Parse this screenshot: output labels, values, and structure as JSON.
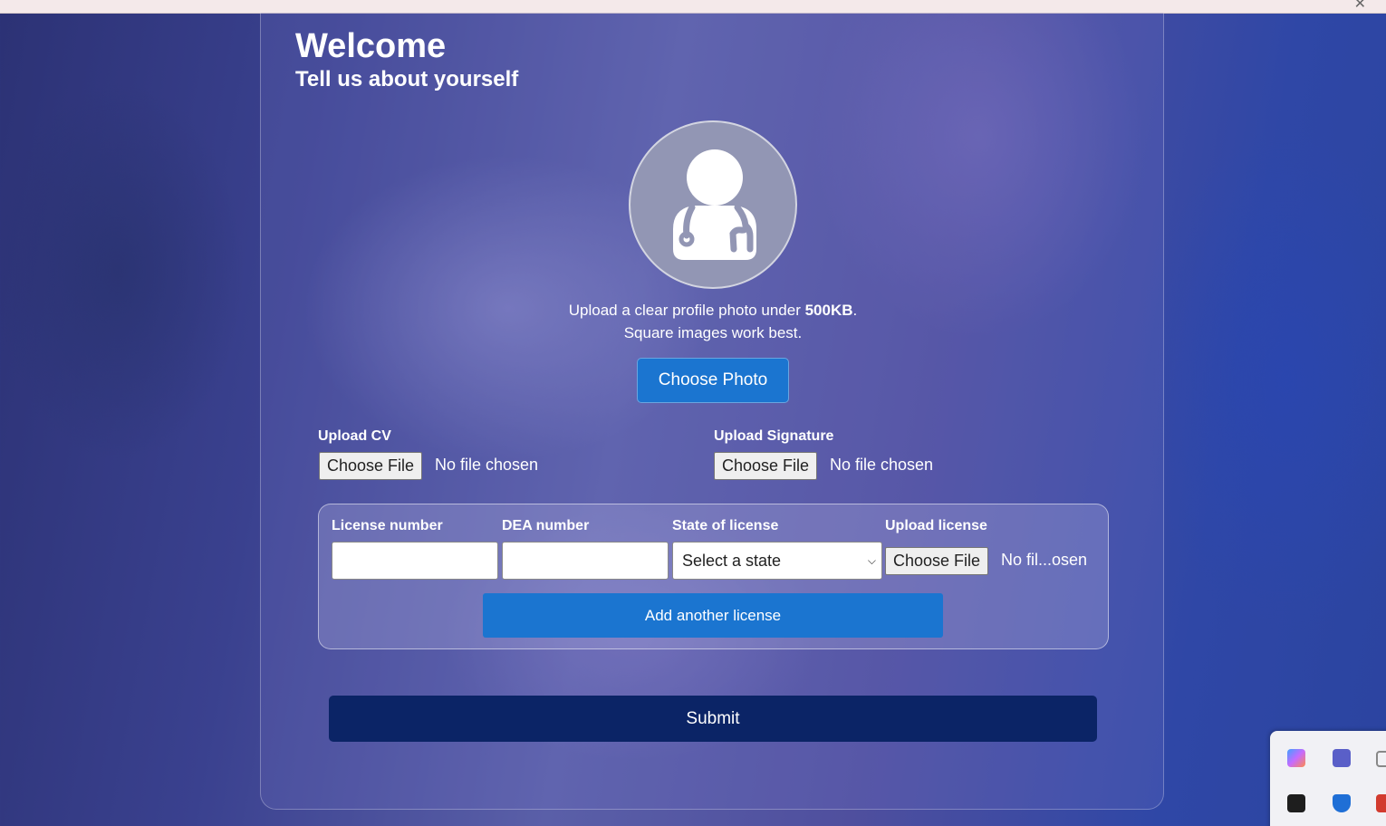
{
  "form": {
    "title": "Welcome",
    "subtitle": "Tell us about yourself",
    "avatar_icon": "doctor-avatar-icon",
    "photo_hint_prefix": "Upload a clear profile photo under ",
    "photo_hint_size": "500KB",
    "photo_hint_suffix": ".",
    "photo_hint_line2": "Square images work best.",
    "choose_photo_label": "Choose Photo",
    "cv": {
      "label": "Upload CV",
      "button": "Choose File",
      "status": "No file chosen"
    },
    "signature": {
      "label": "Upload Signature",
      "button": "Choose File",
      "status": "No file chosen"
    },
    "license": {
      "number_label": "License number",
      "number_value": "",
      "dea_label": "DEA number",
      "dea_value": "",
      "state_label": "State of license",
      "state_selected": "Select a state",
      "upload_label": "Upload license",
      "upload_button": "Choose File",
      "upload_status": "No fil...osen",
      "add_button": "Add another license"
    },
    "submit_label": "Submit"
  },
  "colors": {
    "primary_button": "#1b75d0",
    "submit_button": "#0b2466"
  }
}
